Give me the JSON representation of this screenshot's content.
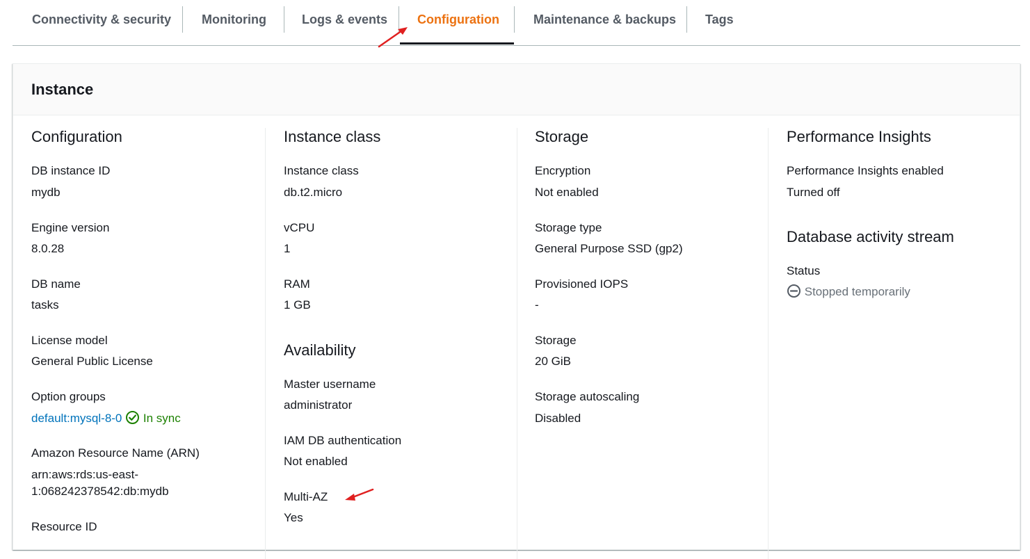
{
  "tabs": [
    {
      "label": "Connectivity & security"
    },
    {
      "label": "Monitoring"
    },
    {
      "label": "Logs & events"
    },
    {
      "label": "Configuration"
    },
    {
      "label": "Maintenance & backups"
    },
    {
      "label": "Tags"
    }
  ],
  "active_tab": "Configuration",
  "colors": {
    "accent": "#ec7211",
    "link": "#0073bb",
    "success": "#1d8102",
    "muted": "#687078",
    "annotation": "#e02020"
  },
  "panel": {
    "title": "Instance",
    "configuration": {
      "title": "Configuration",
      "db_instance_id": {
        "label": "DB instance ID",
        "value": "mydb"
      },
      "engine_version": {
        "label": "Engine version",
        "value": "8.0.28"
      },
      "db_name": {
        "label": "DB name",
        "value": "tasks"
      },
      "license_model": {
        "label": "License model",
        "value": "General Public License"
      },
      "option_groups": {
        "label": "Option groups",
        "link": "default:mysql-8-0",
        "status": "In sync",
        "status_icon": "check-circle-icon"
      },
      "arn": {
        "label": "Amazon Resource Name (ARN)",
        "line1": "arn:aws:rds:us-east-",
        "line2": "1:068242378542:db:mydb"
      },
      "resource_id": {
        "label": "Resource ID"
      }
    },
    "instance_class": {
      "title": "Instance class",
      "instance_class": {
        "label": "Instance class",
        "value": "db.t2.micro"
      },
      "vcpu": {
        "label": "vCPU",
        "value": "1"
      },
      "ram": {
        "label": "RAM",
        "value": "1 GB"
      }
    },
    "availability": {
      "title": "Availability",
      "master_username": {
        "label": "Master username",
        "value": "administrator"
      },
      "iam_auth": {
        "label": "IAM DB authentication",
        "value": "Not enabled"
      },
      "multi_az": {
        "label": "Multi-AZ",
        "value": "Yes"
      }
    },
    "storage": {
      "title": "Storage",
      "encryption": {
        "label": "Encryption",
        "value": "Not enabled"
      },
      "storage_type": {
        "label": "Storage type",
        "value": "General Purpose SSD (gp2)"
      },
      "iops": {
        "label": "Provisioned IOPS",
        "value": "-"
      },
      "storage": {
        "label": "Storage",
        "value": "20 GiB"
      },
      "autoscaling": {
        "label": "Storage autoscaling",
        "value": "Disabled"
      }
    },
    "performance_insights": {
      "title": "Performance Insights",
      "enabled": {
        "label": "Performance Insights enabled",
        "value": "Turned off"
      }
    },
    "activity_stream": {
      "title": "Database activity stream",
      "status": {
        "label": "Status",
        "value": "Stopped temporarily",
        "icon": "minus-circle-icon"
      }
    }
  }
}
